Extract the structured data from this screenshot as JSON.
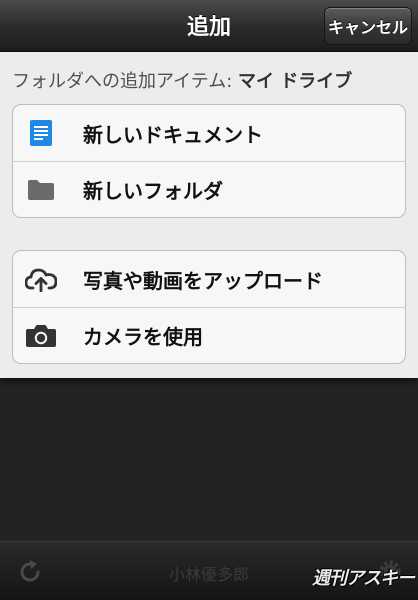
{
  "navbar": {
    "title": "追加",
    "cancel_label": "キャンセル"
  },
  "destination": {
    "prefix": "フォルダへの追加アイテム: ",
    "folder": "マイ ドライブ"
  },
  "create_items": [
    {
      "label": "新しいドキュメント",
      "icon": "document-icon"
    },
    {
      "label": "新しいフォルダ",
      "icon": "folder-icon"
    }
  ],
  "upload_items": [
    {
      "label": "写真や動画をアップロード",
      "icon": "cloud-upload-icon"
    },
    {
      "label": "カメラを使用",
      "icon": "camera-icon"
    }
  ],
  "bottom_bar": {
    "owner": "小林優多郎",
    "watermark": "週刊アスキー"
  },
  "colors": {
    "document_blue": "#1e88e5",
    "folder_gray": "#6b6b6b"
  }
}
